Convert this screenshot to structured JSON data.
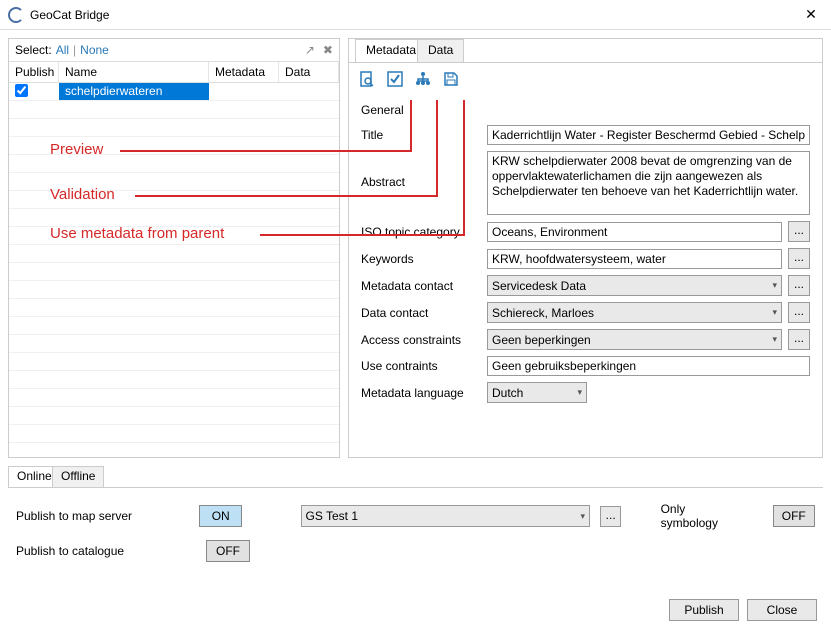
{
  "window": {
    "title": "GeoCat Bridge",
    "close": "✕"
  },
  "select": {
    "label": "Select:",
    "all": "All",
    "none": "None",
    "icon_export": "↗",
    "icon_delete": "✖"
  },
  "table": {
    "headers": {
      "publish": "Publish",
      "name": "Name",
      "metadata": "Metadata",
      "data": "Data"
    },
    "rows": [
      {
        "checked": true,
        "name": "schelpdierwateren"
      }
    ]
  },
  "tabs": {
    "metadata": "Metadata",
    "data": "Data"
  },
  "toolbar": {
    "preview": "🔍",
    "validate": "☑",
    "parent": "⇵",
    "save": "🖫"
  },
  "form": {
    "general": "General",
    "title_label": "Title",
    "title_value": "Kaderrichtlijn Water - Register Beschermd Gebied - Schelp",
    "abstract_label": "Abstract",
    "abstract_value": "KRW schelpdierwater 2008 bevat de omgrenzing van de oppervlaktewaterlichamen die zijn aangewezen als Schelpdierwater ten behoeve van het Kaderrichtlijn water.",
    "iso_label": "ISO topic category",
    "iso_value": "Oceans, Environment",
    "keywords_label": "Keywords",
    "keywords_value": "KRW, hoofdwatersysteem, water",
    "meta_contact_label": "Metadata contact",
    "meta_contact_value": "Servicedesk Data",
    "data_contact_label": "Data contact",
    "data_contact_value": "Schiereck, Marloes",
    "access_label": "Access constraints",
    "access_value": "Geen beperkingen",
    "use_label": "Use contraints",
    "use_value": "Geen gebruiksbeperkingen",
    "lang_label": "Metadata language",
    "lang_value": "Dutch",
    "ellipsis": "..."
  },
  "bottom_tabs": {
    "online": "Online",
    "offline": "Offline"
  },
  "bottom": {
    "pub_maps_label": "Publish to map server",
    "pub_cat_label": "Publish to catalogue",
    "on": "ON",
    "off": "OFF",
    "server": "GS Test 1",
    "only_symbology": "Only symbology"
  },
  "footer": {
    "publish": "Publish",
    "close": "Close"
  },
  "annotations": {
    "preview": "Preview",
    "validation": "Validation",
    "parent": "Use metadata from parent"
  }
}
